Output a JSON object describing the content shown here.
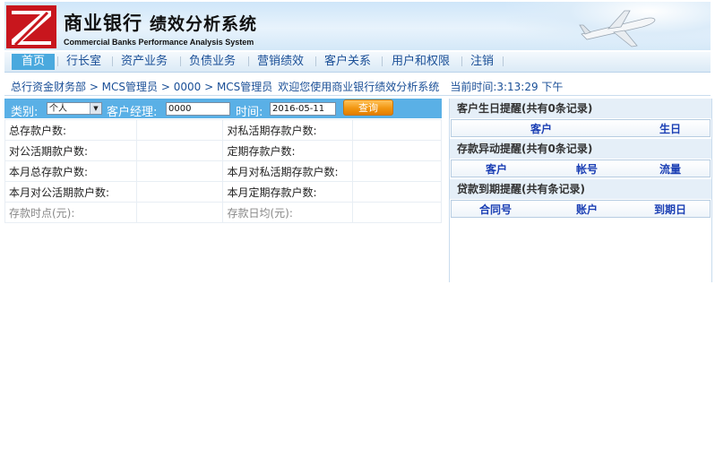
{
  "header": {
    "logo_letter": "Z",
    "title": "商业银行",
    "subtitle": "绩效分析系统",
    "english": "Commercial Banks  Performance Analysis System"
  },
  "nav": {
    "items": [
      "首页",
      "行长室",
      "资产业务",
      "负债业务",
      "营销绩效",
      "客户关系",
      "用户和权限",
      "注销"
    ]
  },
  "breadcrumb": {
    "path": "总行资金财务部 > MCS管理员 > 0000 > MCS管理员",
    "welcome": "欢迎您使用商业银行绩效分析系统",
    "time_label": "当前时间:",
    "time_value": "3:13:29 下午"
  },
  "filter": {
    "category_label": "类别:",
    "category_value": "个人",
    "manager_label": "客户经理:",
    "manager_value": "0000",
    "time_label": "时间:",
    "date_value": "2016-05-11",
    "query_button": "查询"
  },
  "stats": {
    "rows": [
      [
        "总存款户数:",
        "对私活期存款户数:"
      ],
      [
        "对公活期款户数:",
        "定期存款户数:"
      ],
      [
        "本月总存款户数:",
        "本月对私活期存款户数:"
      ],
      [
        "本月对公活期款户数:",
        "本月定期存款户数:"
      ],
      [
        "存款时点(元):",
        "存款日均(元):"
      ]
    ]
  },
  "reminders": {
    "birthday": {
      "title": "客户生日提醒(共有0条记录)",
      "columns": [
        "客户",
        "生日"
      ]
    },
    "deposit": {
      "title": "存款异动提醒(共有0条记录)",
      "columns": [
        "客户",
        "帐号",
        "流量"
      ]
    },
    "loan": {
      "title": "贷款到期提醒(共有条记录)",
      "columns": [
        "合同号",
        "账户",
        "到期日"
      ]
    }
  },
  "colors": {
    "accent": "#4aa9de",
    "filter_bar": "#5ab0e6",
    "link": "#1a4f97",
    "query_button": "#f29611",
    "logo_red": "#c8161d"
  }
}
